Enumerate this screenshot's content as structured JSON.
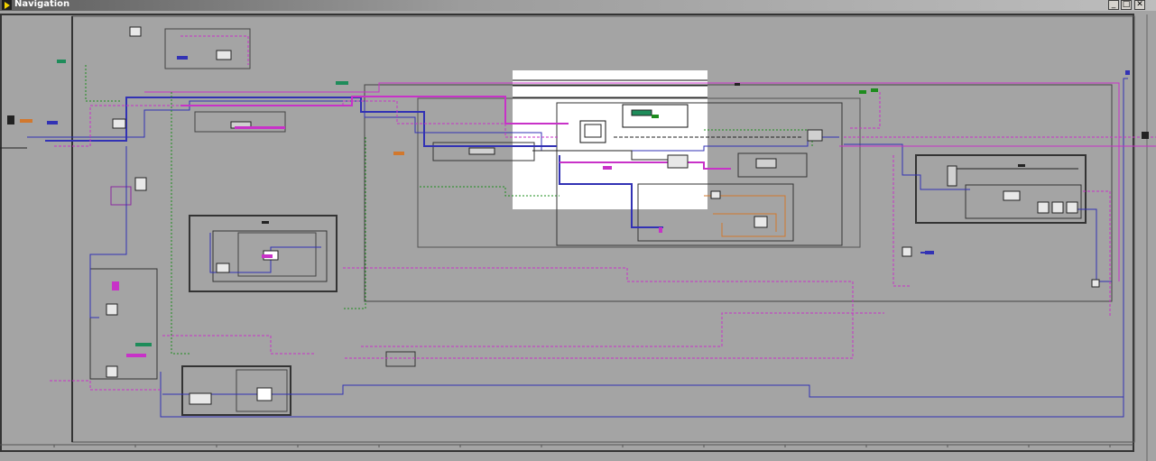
{
  "window": {
    "title": "Navigation",
    "icon": "labview-vi-icon",
    "controls": {
      "minimize": "_",
      "maximize": "□",
      "close": "✕"
    }
  },
  "diagram": {
    "kind": "labview-block-diagram",
    "background_color": "#a4a4a4",
    "wire_colors": {
      "cluster": "#c832c8",
      "integer": "#3232b4",
      "boolean": "#1e8c1e",
      "string": "#d264c8",
      "dbl": "#d2782d"
    },
    "highlight_region_color": "#ffffff"
  }
}
